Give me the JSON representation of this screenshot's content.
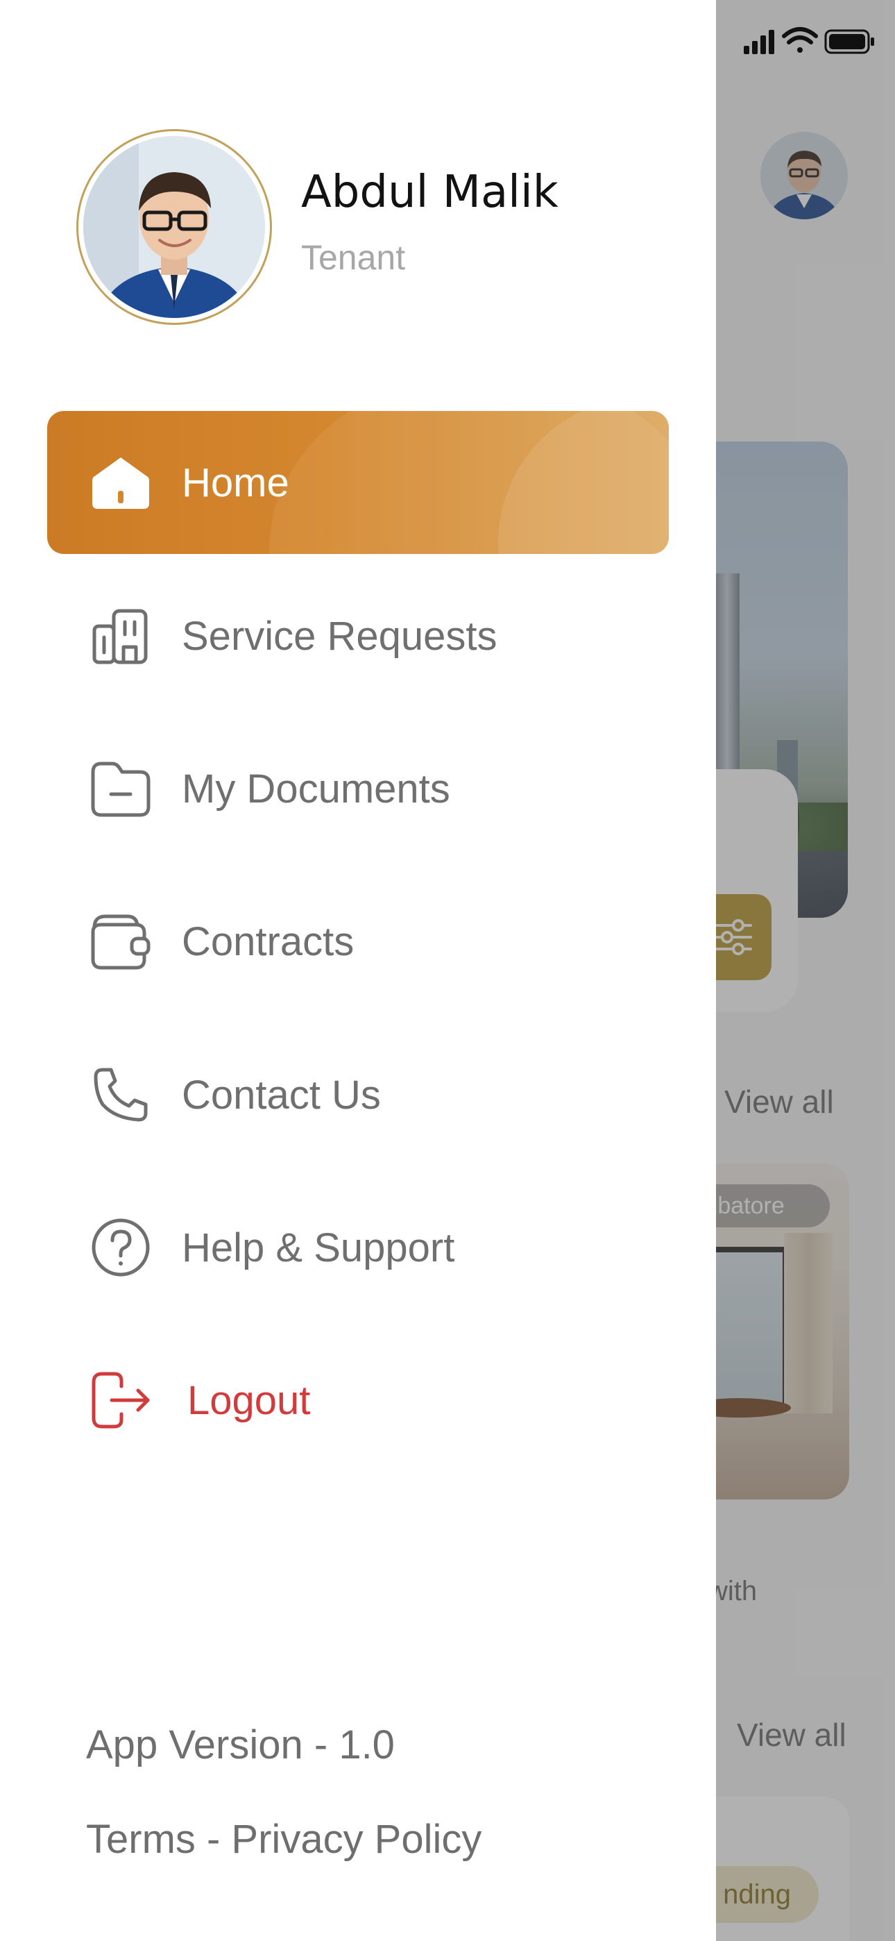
{
  "profile": {
    "name": "Abdul Malik",
    "role": "Tenant"
  },
  "menu": {
    "items": [
      {
        "label": "Home",
        "icon": "home-icon",
        "active": true
      },
      {
        "label": "Service Requests",
        "icon": "building-icon"
      },
      {
        "label": "My Documents",
        "icon": "folder-icon"
      },
      {
        "label": "Contracts",
        "icon": "wallet-icon"
      },
      {
        "label": "Contact Us",
        "icon": "phone-icon"
      },
      {
        "label": "Help & Support",
        "icon": "help-circle-icon"
      },
      {
        "label": "Logout",
        "icon": "logout-icon"
      }
    ]
  },
  "footer": {
    "version": "App Version - 1.0",
    "legal": "Terms - Privacy Policy"
  },
  "background": {
    "view_all_1": "View all",
    "location_chip": "mbatore",
    "snippet": "with",
    "view_all_2": "View all",
    "status_chip": "nding"
  },
  "colors": {
    "accent": "#D4872E",
    "accent_gold": "#C2A15A",
    "logout": "#D23B3B",
    "text_muted": "#6F6F6F"
  }
}
